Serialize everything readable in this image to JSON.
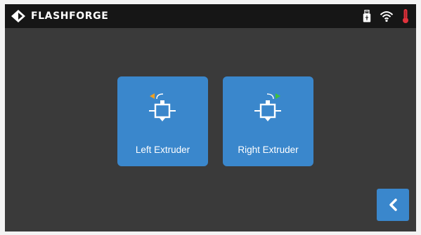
{
  "header": {
    "brand": "FLASHFORGE",
    "icons": [
      "usb-drive-icon",
      "wifi-icon",
      "thermometer-icon"
    ]
  },
  "main": {
    "left_extruder_label": "Left Extruder",
    "right_extruder_label": "Right Extruder"
  },
  "colors": {
    "screen_background": "#3a3a3a",
    "topbar_background": "#161616",
    "tile_blue": "#3a87cc",
    "left_arrow_orange": "#f0a020",
    "right_arrow_green": "#3fbf3f",
    "thermometer_red": "#e0323c"
  }
}
